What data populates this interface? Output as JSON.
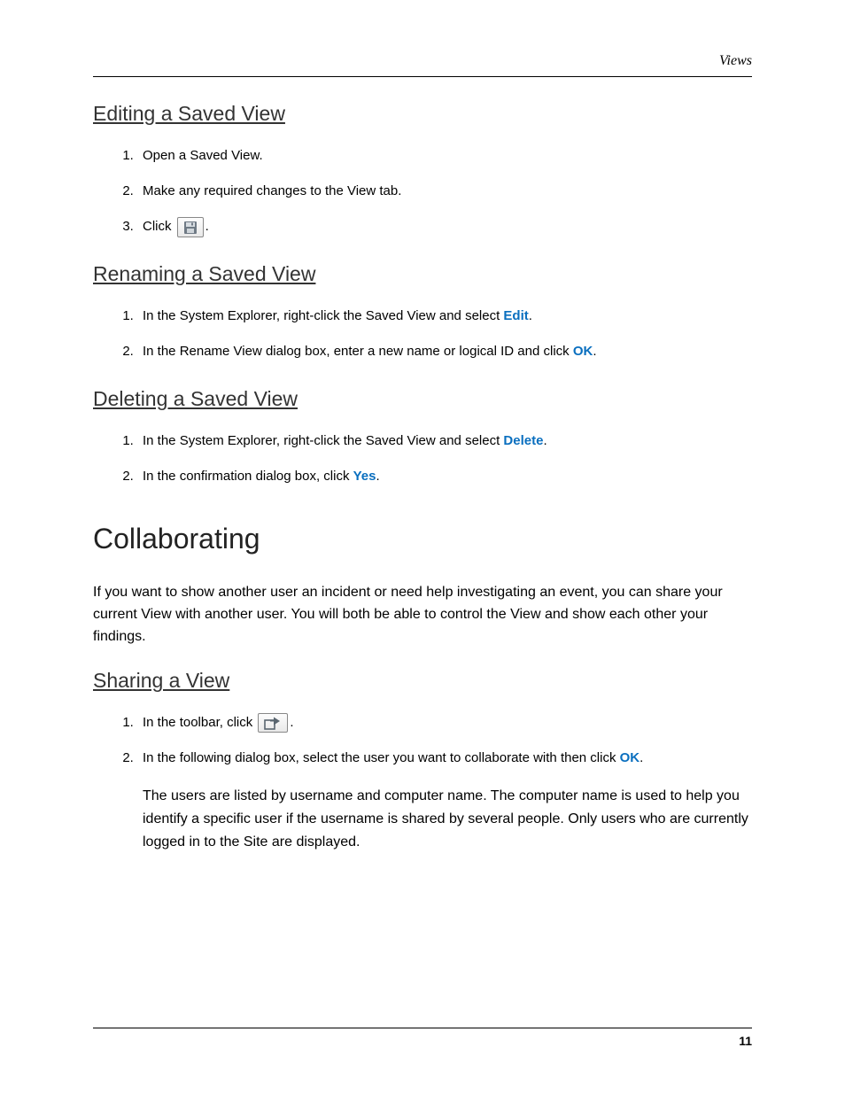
{
  "header": {
    "running_head": "Views"
  },
  "sections": {
    "editing": {
      "title": "Editing a Saved View",
      "steps": {
        "s1": "Open a Saved View.",
        "s2": "Make any required changes to the View tab.",
        "s3_prefix": "Click ",
        "s3_suffix": "."
      }
    },
    "renaming": {
      "title": "Renaming a Saved View",
      "steps": {
        "s1_prefix": "In the System Explorer, right-click the Saved View and select ",
        "s1_action": "Edit",
        "s1_suffix": ".",
        "s2_prefix": "In the Rename View dialog box, enter a new name or logical ID and click ",
        "s2_action": "OK",
        "s2_suffix": "."
      }
    },
    "deleting": {
      "title": "Deleting a Saved View",
      "steps": {
        "s1_prefix": "In the System Explorer, right-click the Saved View and select ",
        "s1_action": "Delete",
        "s1_suffix": ".",
        "s2_prefix": "In the confirmation dialog box, click ",
        "s2_action": "Yes",
        "s2_suffix": "."
      }
    },
    "collaborating": {
      "title": "Collaborating",
      "intro": "If you want to show another user an incident or need help investigating an event, you can share your current View with another user. You will both be able to control the View and show each other your findings."
    },
    "sharing": {
      "title": "Sharing a View",
      "steps": {
        "s1_prefix": "In the toolbar, click ",
        "s1_suffix": ".",
        "s2_prefix": "In the following dialog box, select the user you want to collaborate with then click ",
        "s2_action": "OK",
        "s2_suffix": ".",
        "s2_note": "The users are listed by username and computer name. The computer name is used to help you identify a specific user if the username is shared by several people. Only users who are currently logged in to the Site are displayed."
      }
    }
  },
  "footer": {
    "page_number": "11"
  }
}
